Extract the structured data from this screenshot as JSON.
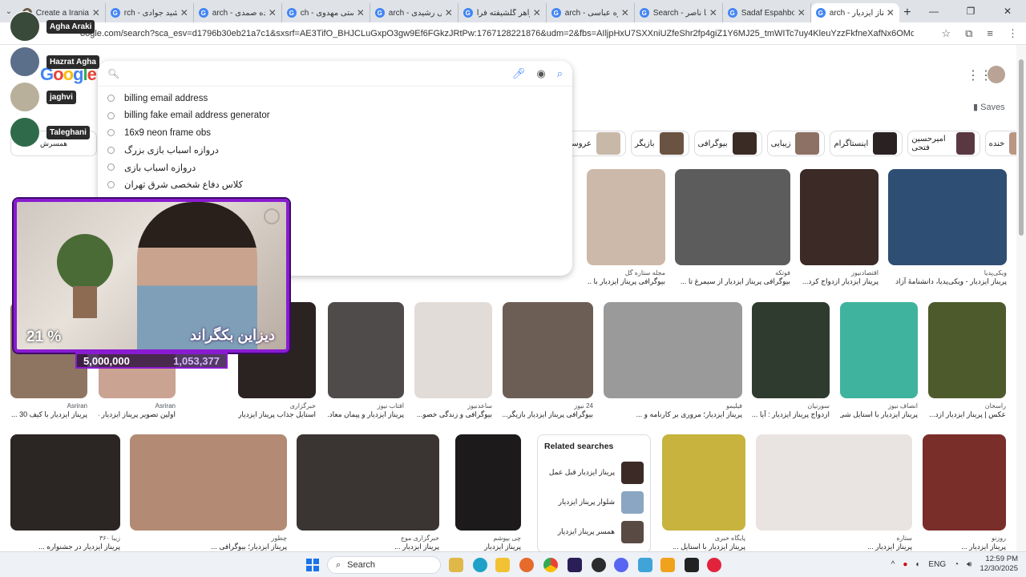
{
  "tabs": [
    {
      "title": "Create a Iranian A",
      "fav": "#6b5b4a",
      "active": false
    },
    {
      "title": "rch - مهشید جوادی",
      "fav": "#4285f4",
      "active": false
    },
    {
      "title": "arch - ازاده صمدی",
      "fav": "#4285f4",
      "active": false
    },
    {
      "title": "ch - هستی مهدوی",
      "fav": "#4285f4",
      "active": false
    },
    {
      "title": "arch - لیلی رشیدی",
      "fav": "#4285f4",
      "active": false
    },
    {
      "title": "خواهر گلشیفته فرا",
      "fav": "#4285f4",
      "active": false
    },
    {
      "title": "arch - گلاره عباسی",
      "fav": "#4285f4",
      "active": false
    },
    {
      "title": "Search - یکتا ناصر",
      "fav": "#4285f4",
      "active": false
    },
    {
      "title": "Sadaf Espahbodi",
      "fav": "#4285f4",
      "active": false
    },
    {
      "title": "arch - پریناز ایزدیار",
      "fav": "#4285f4",
      "active": true
    }
  ],
  "address": {
    "url": "oogle.com/search?sca_esv=d1796b30eb21a7c1&sxsrf=AE3TifO_BHJCLuGxpO3gw9Ef6FGkzJRtPw:1767128221876&udm=2&fbs=AIljpHxU7SXXniUZfeShr2fp4giZ1Y6MJ25_tmWITc7uy4KleuYzzFkfneXafNx6OMdA4MQRJc_t_TQjwHYrzlklauOKiWCnruNf..."
  },
  "google": {
    "logo": "Google",
    "saves": "Saves"
  },
  "search": {
    "placeholder": "",
    "suggestions": [
      "billing email address",
      "billing fake email address generator",
      "16x9 neon frame obs",
      "دروازه اسباب بازی بزرگ",
      "دروازه اسباب بازی",
      "کلاس دفاع شخصی شرق تهران"
    ]
  },
  "chips": [
    {
      "label": "عروسی",
      "color": "#c8b8a8"
    },
    {
      "label": "بازیگر",
      "color": "#6b5342"
    },
    {
      "label": "بیوگرافی",
      "color": "#3b2b25"
    },
    {
      "label": "زیبایی",
      "color": "#8c7164"
    },
    {
      "label": "اینستاگرام",
      "color": "#2a2222"
    },
    {
      "label": "امیرحسین فتحی",
      "color": "#5a3842"
    },
    {
      "label": "خنده",
      "color": "#b99682"
    }
  ],
  "left_chip": {
    "label": "همسرش"
  },
  "rows": [
    {
      "cards": [
        {
          "src": "مجله ستاره گل",
          "cap": "بیوگرافی پریناز ایزدیار با ...",
          "color": "#cdb9a9"
        },
        {
          "src": "فوتکه",
          "cap": "بیوگرافی پریناز ایزدیار از سیمرغ تا ...",
          "color": "#5c5c5c"
        },
        {
          "src": "اقتصادنیوز",
          "cap": "پریناز ایزدیار ازدواج کرد...",
          "color": "#3b2a26"
        },
        {
          "src": "ویکی‌پدیا",
          "cap": "پریناز ایزدیار - ویکی‌پدیا، دانشنامهٔ آزاد",
          "color": "#2f4e73"
        }
      ]
    },
    {
      "cards": [
        {
          "src": "Asriran",
          "cap": "پریناز ایزدیار با کیف 30 ...",
          "color": "#8d7562"
        },
        {
          "src": "Asriran",
          "cap": "اولین تصویر پریناز ایزدیار در فیلم ...",
          "color": "#caa392"
        },
        {
          "src": "خبرگزاری",
          "cap": "استایل جذاب پریناز ایزدیار در ...",
          "color": "#2b2321"
        },
        {
          "src": "آفتاب نیوز",
          "cap": "پریناز ایزدیار و پیمان معاد...",
          "color": "#4f4b4a"
        },
        {
          "src": "ساعدنیوز",
          "cap": "بیوگرافی و زندگی خصو...",
          "color": "#e1dcd8"
        },
        {
          "src": "24 نیوز",
          "cap": "بیوگرافی پریناز ایزدیار بازیگر...",
          "color": "#6d5e55"
        },
        {
          "src": "فیلیمو",
          "cap": "پریناز ایزدیار؛ مروری بر کارنامه و ...",
          "color": "#9a9a9a"
        },
        {
          "src": "سورنیان",
          "cap": "ازدواج پریناز ایزدیار : آیا ...",
          "color": "#2f3b2f"
        },
        {
          "src": "انصاف نیوز",
          "cap": "پریناز ایزدیار با استایل شی...",
          "color": "#3fb39d"
        },
        {
          "src": "راسخان",
          "cap": "عکس | پریناز ایزدیار ازد...",
          "color": "#4d5a2c"
        }
      ]
    },
    {
      "cards": [
        {
          "src": "زیبا ۳۶۰",
          "cap": "پریناز ایزدیار در جشنواره ...",
          "color": "#2b2523"
        },
        {
          "src": "چطور",
          "cap": "پریناز ایزدیار؛ بیوگرافی ...",
          "color": "#b38b74"
        },
        {
          "src": "خبرگزاری موج",
          "cap": "پریناز ایزدیار ...",
          "color": "#3a3433"
        },
        {
          "src": "چی بپوشم",
          "cap": "پریناز ایزدیار",
          "color": "#1c1a1a"
        },
        {
          "src": "پایگاه خبری",
          "cap": "پریناز ایزدیار با استایل ...",
          "color": "#c7b33e"
        },
        {
          "src": "ستاره",
          "cap": "پریناز ایزدیار ...",
          "color": "#e9e4e1"
        },
        {
          "src": "روزنو",
          "cap": "پریناز ایزدیار ...",
          "color": "#7a2e2a"
        }
      ]
    }
  ],
  "related": {
    "title": "Related searches",
    "items": [
      "پریناز ایزدیار قبل عمل",
      "شلوار پریناز ایزدیار",
      "همسر پریناز ایزدیار"
    ]
  },
  "profiles": [
    {
      "name": "Agha Araki",
      "color": "#3a4a3a"
    },
    {
      "name": "Hazrat Agha",
      "color": "#5b6e8a"
    },
    {
      "name": "jaghvi",
      "color": "#b8b09a"
    },
    {
      "name": "Taleghani",
      "color": "#2f6b4a"
    }
  ],
  "cam": {
    "percent": "21 %",
    "overlay": "دیزاین بکگراند",
    "goal_total": "5,000,000",
    "goal_current": "1,053,377"
  },
  "taskbar": {
    "search": "Search",
    "lang": "ENG",
    "time": "12:59 PM",
    "date": "12/30/2025"
  }
}
